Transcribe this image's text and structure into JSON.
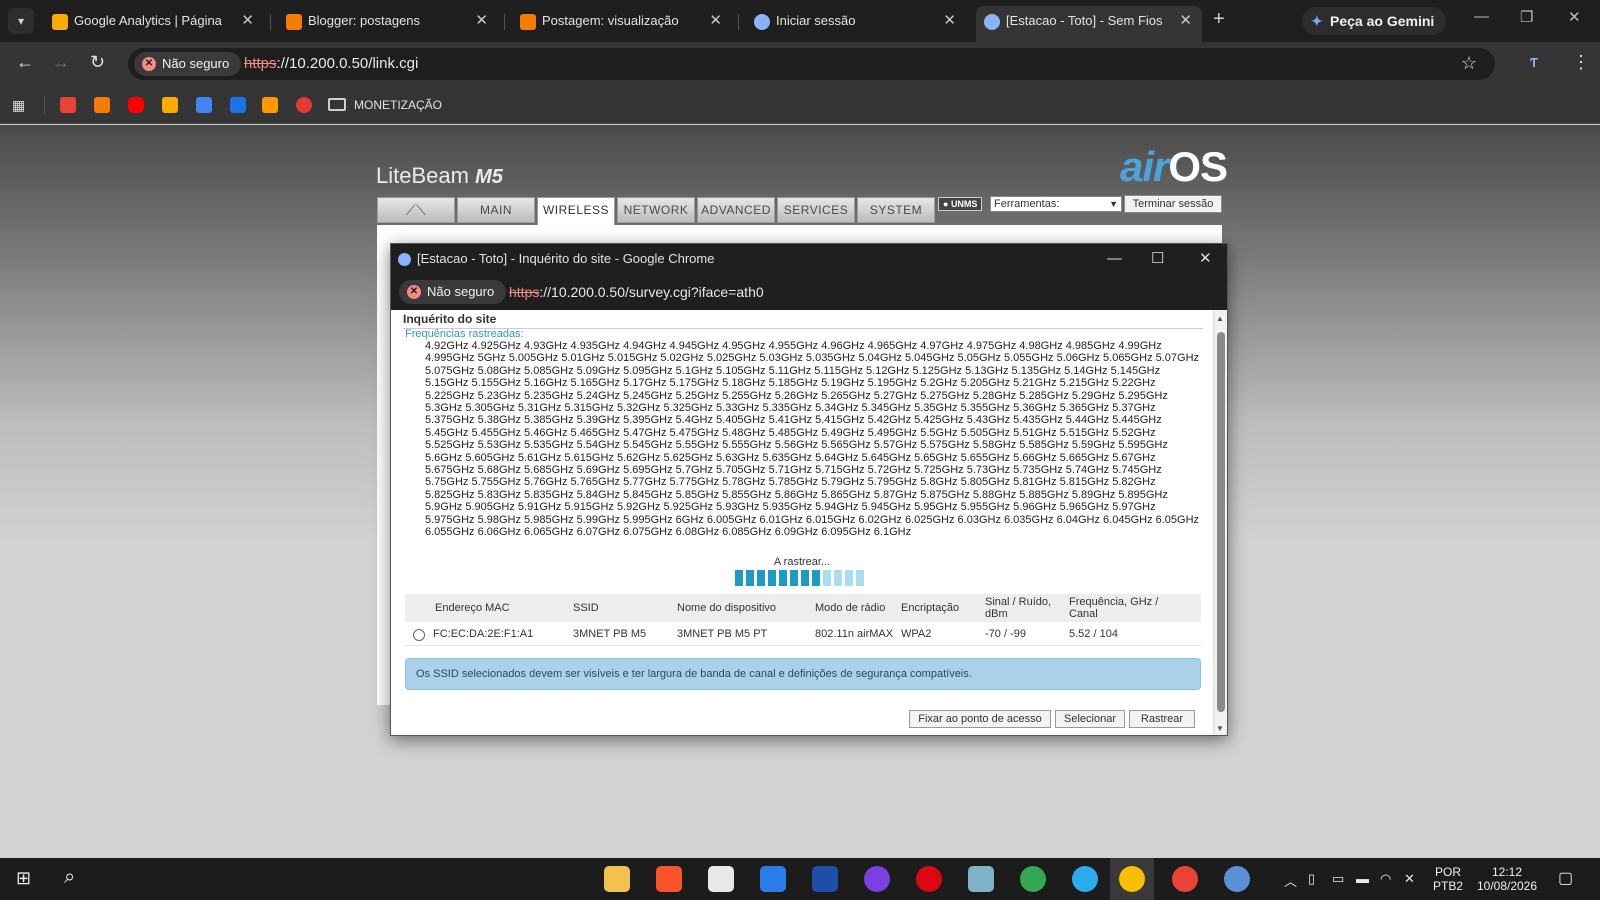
{
  "browser": {
    "tabs": [
      {
        "title": "Google Analytics | Página inic",
        "icon": "analytics-icon",
        "color": "#f9ab00"
      },
      {
        "title": "Blogger: postagens",
        "icon": "blogger-icon",
        "color": "#f57c00"
      },
      {
        "title": "Postagem: visualização",
        "icon": "blogger-icon",
        "color": "#f57c00"
      },
      {
        "title": "Iniciar sessão",
        "icon": "ubiquiti-icon",
        "color": "#8ab4f8"
      },
      {
        "title": "[Estacao - Toto] - Sem Fios",
        "icon": "ubiquiti-icon",
        "color": "#8ab4f8"
      }
    ],
    "gemini_label": "Peça ao Gemini",
    "security_label": "Não seguro",
    "url_scheme": "https",
    "url_rest": "://10.200.0.50/link.cgi",
    "bookmark_folder": "MONETIZAÇÃO"
  },
  "page": {
    "brand": "LiteBeam",
    "brand_model": "M5",
    "logo_air": "air",
    "logo_os": "OS",
    "nav_tabs": [
      "MAIN",
      "WIRELESS",
      "NETWORK",
      "ADVANCED",
      "SERVICES",
      "SYSTEM"
    ],
    "unms_badge": "UNMS",
    "tools_select": "Ferramentas:",
    "logout_label": "Terminar sessão"
  },
  "popup": {
    "window_title": "[Estacao - Toto] - Inquérito do site - Google Chrome",
    "security_label": "Não seguro",
    "url_scheme": "https",
    "url_rest": "://10.200.0.50/survey.cgi?iface=ath0",
    "section_title": "Inquérito do site",
    "freq_label": "Frequências rastreadas:",
    "frequencies": "4.92GHz 4.925GHz 4.93GHz 4.935GHz 4.94GHz 4.945GHz 4.95GHz 4.955GHz 4.96GHz 4.965GHz 4.97GHz 4.975GHz 4.98GHz 4.985GHz 4.99GHz 4.995GHz 5GHz 5.005GHz 5.01GHz 5.015GHz 5.02GHz 5.025GHz 5.03GHz 5.035GHz 5.04GHz 5.045GHz 5.05GHz 5.055GHz 5.06GHz 5.065GHz 5.07GHz 5.075GHz 5.08GHz 5.085GHz 5.09GHz 5.095GHz 5.1GHz 5.105GHz 5.11GHz 5.115GHz 5.12GHz 5.125GHz 5.13GHz 5.135GHz 5.14GHz 5.145GHz 5.15GHz 5.155GHz 5.16GHz 5.165GHz 5.17GHz 5.175GHz 5.18GHz 5.185GHz 5.19GHz 5.195GHz 5.2GHz 5.205GHz 5.21GHz 5.215GHz 5.22GHz 5.225GHz 5.23GHz 5.235GHz 5.24GHz 5.245GHz 5.25GHz 5.255GHz 5.26GHz 5.265GHz 5.27GHz 5.275GHz 5.28GHz 5.285GHz 5.29GHz 5.295GHz 5.3GHz 5.305GHz 5.31GHz 5.315GHz 5.32GHz 5.325GHz 5.33GHz 5.335GHz 5.34GHz 5.345GHz 5.35GHz 5.355GHz 5.36GHz 5.365GHz 5.37GHz 5.375GHz 5.38GHz 5.385GHz 5.39GHz 5.395GHz 5.4GHz 5.405GHz 5.41GHz 5.415GHz 5.42GHz 5.425GHz 5.43GHz 5.435GHz 5.44GHz 5.445GHz 5.45GHz 5.455GHz 5.46GHz 5.465GHz 5.47GHz 5.475GHz 5.48GHz 5.485GHz 5.49GHz 5.495GHz 5.5GHz 5.505GHz 5.51GHz 5.515GHz 5.52GHz 5.525GHz 5.53GHz 5.535GHz 5.54GHz 5.545GHz 5.55GHz 5.555GHz 5.56GHz 5.565GHz 5.57GHz 5.575GHz 5.58GHz 5.585GHz 5.59GHz 5.595GHz 5.6GHz 5.605GHz 5.61GHz 5.615GHz 5.62GHz 5.625GHz 5.63GHz 5.635GHz 5.64GHz 5.645GHz 5.65GHz 5.655GHz 5.66GHz 5.665GHz 5.67GHz 5.675GHz 5.68GHz 5.685GHz 5.69GHz 5.695GHz 5.7GHz 5.705GHz 5.71GHz 5.715GHz 5.72GHz 5.725GHz 5.73GHz 5.735GHz 5.74GHz 5.745GHz 5.75GHz 5.755GHz 5.76GHz 5.765GHz 5.77GHz 5.775GHz 5.78GHz 5.785GHz 5.79GHz 5.795GHz 5.8GHz 5.805GHz 5.81GHz 5.815GHz 5.82GHz 5.825GHz 5.83GHz 5.835GHz 5.84GHz 5.845GHz 5.85GHz 5.855GHz 5.86GHz 5.865GHz 5.87GHz 5.875GHz 5.88GHz 5.885GHz 5.89GHz 5.895GHz 5.9GHz 5.905GHz 5.91GHz 5.915GHz 5.92GHz 5.925GHz 5.93GHz 5.935GHz 5.94GHz 5.945GHz 5.95GHz 5.955GHz 5.96GHz 5.965GHz 5.97GHz 5.975GHz 5.98GHz 5.985GHz 5.99GHz 5.995GHz 6GHz 6.005GHz 6.01GHz 6.015GHz 6.02GHz 6.025GHz 6.03GHz 6.035GHz 6.04GHz 6.045GHz 6.05GHz 6.055GHz 6.06GHz 6.065GHz 6.07GHz 6.075GHz 6.08GHz 6.085GHz 6.09GHz 6.095GHz 6.1GHz",
    "scanning_label": "A rastrear...",
    "progress": {
      "total_segments": 12,
      "filled_segments": 8,
      "color_filled": "#1d9bc4",
      "color_empty": "#a8dcef"
    },
    "table": {
      "headers": [
        "Endereço MAC",
        "SSID",
        "Nome do dispositivo",
        "Modo de rádio",
        "Encriptação",
        "Sinal / Ruído, dBm",
        "Frequência, GHz / Canal"
      ],
      "rows": [
        [
          "FC:EC:DA:2E:F1:A1",
          "3MNET PB M5",
          "3MNET PB M5 PT",
          "802.11n airMAX",
          "WPA2",
          "-70 / -99",
          "5.52 / 104"
        ]
      ]
    },
    "info_message": "Os SSID selecionados devem ser visíveis e ter largura de banda de canal e definições de segurança compatíveis.",
    "buttons": {
      "lock_ap": "Fixar ao ponto de acesso",
      "select": "Selecionar",
      "scan": "Rastrear"
    }
  },
  "taskbar": {
    "lang_top": "POR",
    "lang_bottom": "PTB2",
    "time": "12:12",
    "date": "10/08/2026"
  }
}
